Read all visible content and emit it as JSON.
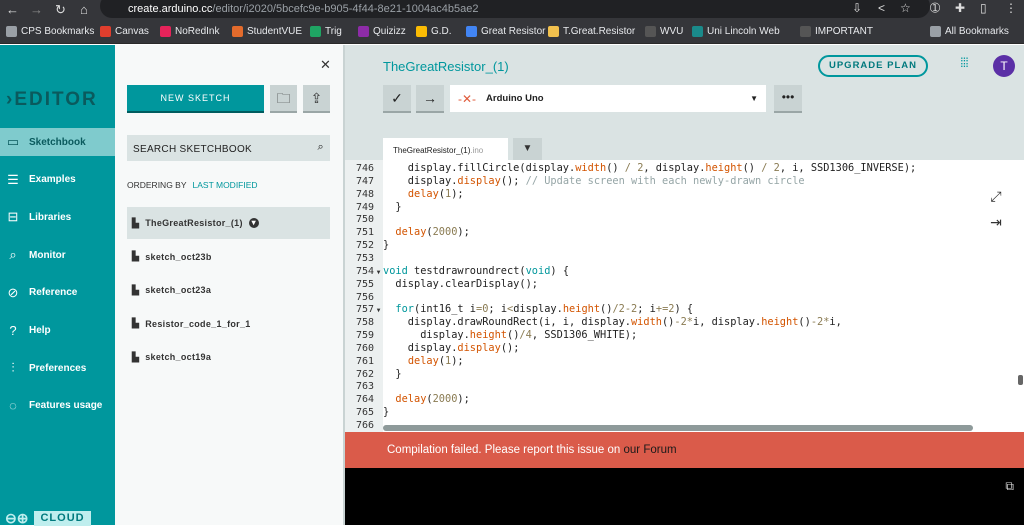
{
  "browser": {
    "url_host": "create.arduino.cc",
    "url_path": "/editor/i2020/5bcefc9e-b905-4f44-8e21-1004ac4b5ae2",
    "bookmarks": [
      {
        "label": "CPS Bookmarks",
        "icon": "folder-icon",
        "color": "#9aa0a6"
      },
      {
        "label": "Canvas",
        "icon": "canvas-icon",
        "color": "#e03e2d"
      },
      {
        "label": "NoRedInk",
        "icon": "noredink-icon",
        "color": "#e6235a"
      },
      {
        "label": "StudentVUE",
        "icon": "studentvue-icon",
        "color": "#e36b2c"
      },
      {
        "label": "Trig",
        "icon": "trig-icon",
        "color": "#1fa463"
      },
      {
        "label": "Quizizz",
        "icon": "quizizz-icon",
        "color": "#8e2ca8"
      },
      {
        "label": "G.D.",
        "icon": "drive-icon",
        "color": "#fbbc04"
      },
      {
        "label": "Great Resistor",
        "icon": "docs-icon",
        "color": "#4285f4"
      },
      {
        "label": "T.Great.Resistor",
        "icon": "image-icon",
        "color": "#f2c14e"
      },
      {
        "label": "WVU",
        "icon": "wvu-icon",
        "color": "#555"
      },
      {
        "label": "Uni Lincoln Web",
        "icon": "lincoln-icon",
        "color": "#1a8a8a"
      },
      {
        "label": "IMPORTANT",
        "icon": "important-icon",
        "color": "#555"
      }
    ],
    "all_bookmarks": "All Bookmarks"
  },
  "sidebar": {
    "logo": "EDITOR",
    "items": [
      {
        "label": "Sketchbook",
        "icon": "folder-icon",
        "glyph": "▭"
      },
      {
        "label": "Examples",
        "icon": "list-icon",
        "glyph": "☰"
      },
      {
        "label": "Libraries",
        "icon": "library-icon",
        "glyph": "⊟"
      },
      {
        "label": "Monitor",
        "icon": "monitor-icon",
        "glyph": "⌕"
      },
      {
        "label": "Reference",
        "icon": "compass-icon",
        "glyph": "⊘"
      },
      {
        "label": "Help",
        "icon": "help-icon",
        "glyph": "?"
      },
      {
        "label": "Preferences",
        "icon": "sliders-icon",
        "glyph": "⫶"
      },
      {
        "label": "Features usage",
        "icon": "usage-icon",
        "glyph": "◌"
      }
    ],
    "cloud": "CLOUD"
  },
  "panel": {
    "new_sketch": "NEW SKETCH",
    "search_placeholder": "SEARCH SKETCHBOOK",
    "ordering_label": "ORDERING BY",
    "ordering_value": "LAST MODIFIED",
    "sketches": [
      "TheGreatResistor_(1)",
      "sketch_oct23b",
      "sketch_oct23a",
      "Resistor_code_1_for_1",
      "sketch_oct19a"
    ]
  },
  "editor": {
    "title": "TheGreatResistor_(1)",
    "upgrade": "UPGRADE PLAN",
    "avatar": "T",
    "board": "Arduino Uno",
    "file_name": "TheGreatResistor_(1)",
    "file_ext": ".ino",
    "code": [
      {
        "n": "746",
        "fold": false,
        "seg": [
          [
            "p",
            "    display.fillCircle(display."
          ],
          [
            "f",
            "width"
          ],
          [
            "p",
            "() "
          ],
          [
            "n",
            "/ 2"
          ],
          [
            "p",
            ", display."
          ],
          [
            "f",
            "height"
          ],
          [
            "p",
            "() "
          ],
          [
            "n",
            "/ 2"
          ],
          [
            "p",
            ", i, SSD1306_INVERSE);"
          ]
        ]
      },
      {
        "n": "747",
        "fold": false,
        "seg": [
          [
            "p",
            "    display."
          ],
          [
            "f",
            "display"
          ],
          [
            "p",
            "(); "
          ],
          [
            "c",
            "// Update screen with each newly-drawn circle"
          ]
        ]
      },
      {
        "n": "748",
        "fold": false,
        "seg": [
          [
            "p",
            "    "
          ],
          [
            "f",
            "delay"
          ],
          [
            "p",
            "("
          ],
          [
            "n",
            "1"
          ],
          [
            "p",
            ");"
          ]
        ]
      },
      {
        "n": "749",
        "fold": false,
        "seg": [
          [
            "p",
            "  }"
          ]
        ]
      },
      {
        "n": "750",
        "fold": false,
        "seg": []
      },
      {
        "n": "751",
        "fold": false,
        "seg": [
          [
            "p",
            "  "
          ],
          [
            "f",
            "delay"
          ],
          [
            "p",
            "("
          ],
          [
            "n",
            "2000"
          ],
          [
            "p",
            ");"
          ]
        ]
      },
      {
        "n": "752",
        "fold": false,
        "seg": [
          [
            "p",
            "}"
          ]
        ]
      },
      {
        "n": "753",
        "fold": false,
        "seg": []
      },
      {
        "n": "754",
        "fold": true,
        "seg": [
          [
            "k",
            "void"
          ],
          [
            "p",
            " testdrawroundrect("
          ],
          [
            "k",
            "void"
          ],
          [
            "p",
            ") {"
          ]
        ]
      },
      {
        "n": "755",
        "fold": false,
        "seg": [
          [
            "p",
            "  display.clearDisplay();"
          ]
        ]
      },
      {
        "n": "756",
        "fold": false,
        "seg": []
      },
      {
        "n": "757",
        "fold": true,
        "seg": [
          [
            "p",
            "  "
          ],
          [
            "k",
            "for"
          ],
          [
            "p",
            "(int16_t i"
          ],
          [
            "n",
            "=0"
          ],
          [
            "p",
            "; i"
          ],
          [
            "n",
            "<"
          ],
          [
            "p",
            "display."
          ],
          [
            "f",
            "height"
          ],
          [
            "p",
            "()"
          ],
          [
            "n",
            "/2-2"
          ],
          [
            "p",
            "; i"
          ],
          [
            "n",
            "+=2"
          ],
          [
            "p",
            ") {"
          ]
        ]
      },
      {
        "n": "758",
        "fold": false,
        "seg": [
          [
            "p",
            "    display.drawRoundRect(i, i, display."
          ],
          [
            "f",
            "width"
          ],
          [
            "p",
            "()"
          ],
          [
            "n",
            "-2*"
          ],
          [
            "p",
            "i, display."
          ],
          [
            "f",
            "height"
          ],
          [
            "p",
            "()"
          ],
          [
            "n",
            "-2*"
          ],
          [
            "p",
            "i,"
          ]
        ]
      },
      {
        "n": "759",
        "fold": false,
        "seg": [
          [
            "p",
            "      display."
          ],
          [
            "f",
            "height"
          ],
          [
            "p",
            "()"
          ],
          [
            "n",
            "/4"
          ],
          [
            "p",
            ", SSD1306_WHITE);"
          ]
        ]
      },
      {
        "n": "760",
        "fold": false,
        "seg": [
          [
            "p",
            "    display."
          ],
          [
            "f",
            "display"
          ],
          [
            "p",
            "();"
          ]
        ]
      },
      {
        "n": "761",
        "fold": false,
        "seg": [
          [
            "p",
            "    "
          ],
          [
            "f",
            "delay"
          ],
          [
            "p",
            "("
          ],
          [
            "n",
            "1"
          ],
          [
            "p",
            ");"
          ]
        ]
      },
      {
        "n": "762",
        "fold": false,
        "seg": [
          [
            "p",
            "  }"
          ]
        ]
      },
      {
        "n": "763",
        "fold": false,
        "seg": []
      },
      {
        "n": "764",
        "fold": false,
        "seg": [
          [
            "p",
            "  "
          ],
          [
            "f",
            "delay"
          ],
          [
            "p",
            "("
          ],
          [
            "n",
            "2000"
          ],
          [
            "p",
            ");"
          ]
        ]
      },
      {
        "n": "765",
        "fold": false,
        "seg": [
          [
            "p",
            "}"
          ]
        ]
      },
      {
        "n": "766",
        "fold": false,
        "seg": []
      }
    ]
  },
  "status": {
    "message": "Compilation failed. Please report this issue on ",
    "link_our": "our",
    "link_forum": "Forum"
  }
}
